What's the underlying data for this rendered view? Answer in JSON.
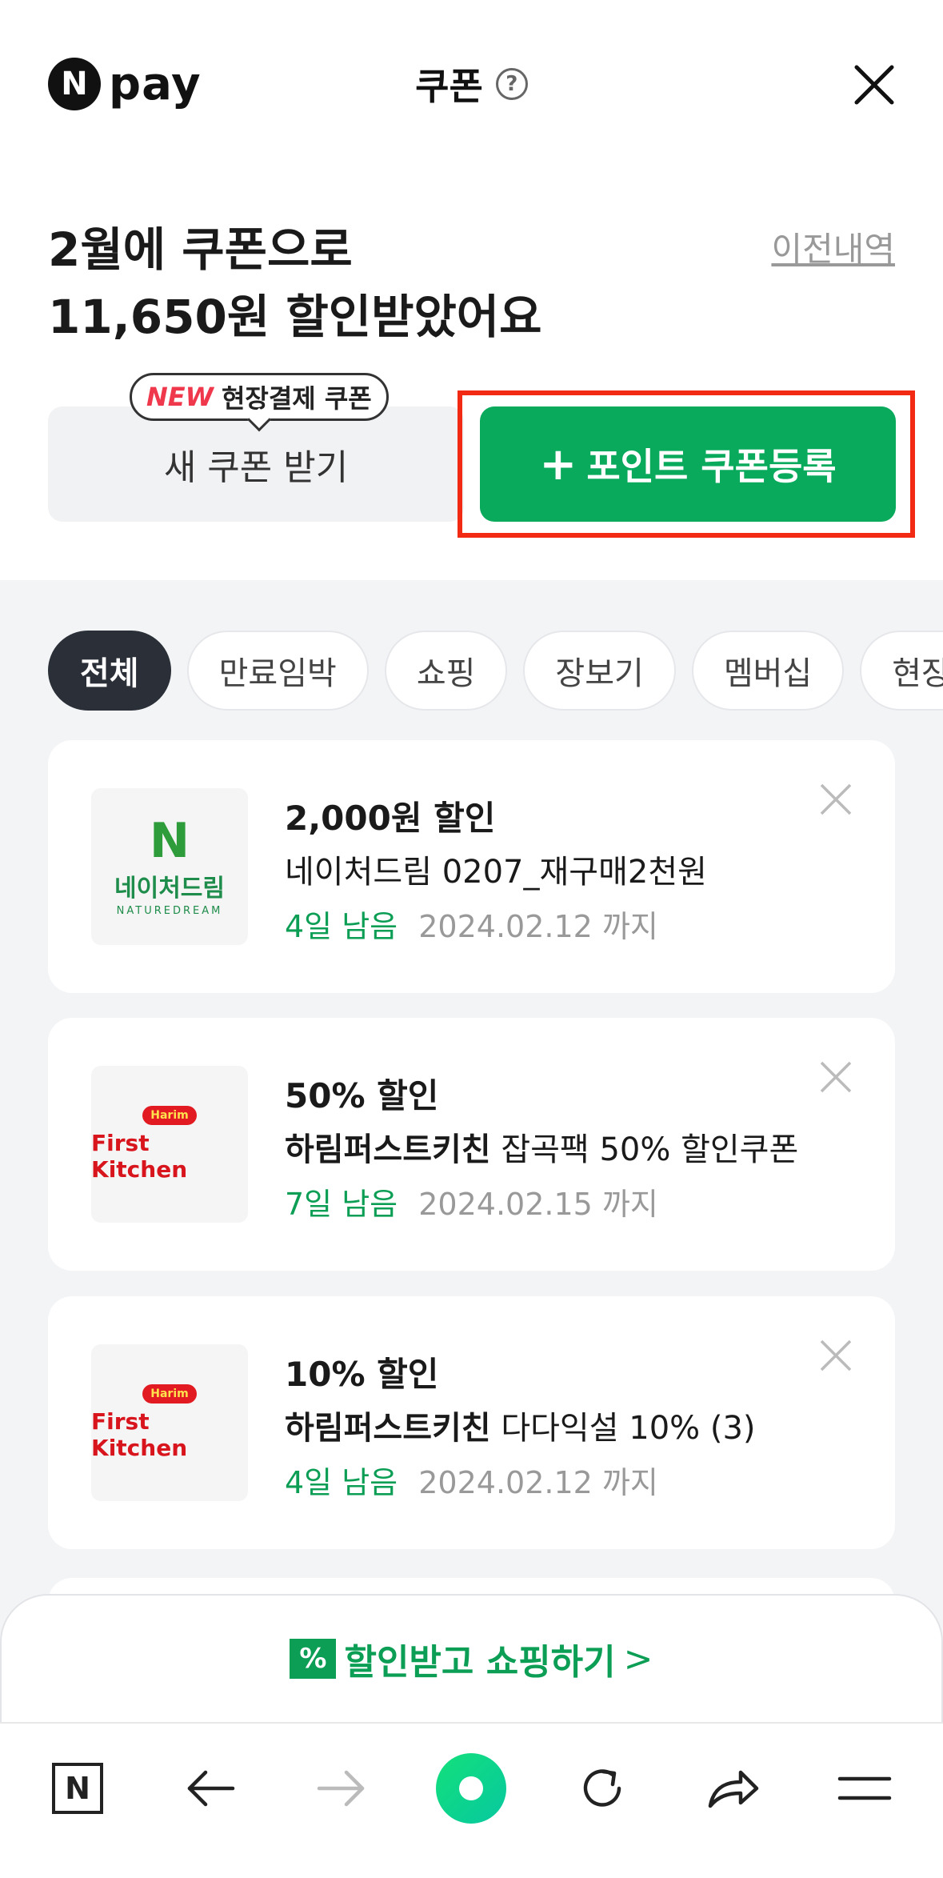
{
  "header": {
    "logo_letter": "N",
    "logo_text": "pay",
    "title": "쿠폰",
    "help_icon": "?"
  },
  "summary": {
    "line1": "2월에 쿠폰으로",
    "line2": "11,650원 할인받았어요",
    "history_link": "이전내역"
  },
  "actions": {
    "tooltip_new": "NEW",
    "tooltip_text": "현장결제 쿠폰",
    "new_coupon_label": "새 쿠폰 받기",
    "point_coupon_plus": "+",
    "point_coupon_label": "포인트 쿠폰등록"
  },
  "filters": [
    "전체",
    "만료임박",
    "쇼핑",
    "장보기",
    "멤버십",
    "현장"
  ],
  "coupons": [
    {
      "discount": "2,000원 할인",
      "brand": "",
      "title": "네이처드림 0207_재구매2천원",
      "days_left": "4일 남음",
      "until": "2024.02.12 까지",
      "logo": {
        "mark": "N",
        "name": "네이처드림",
        "sub": "NATUREDREAM"
      }
    },
    {
      "discount": "50% 할인",
      "brand": "하림퍼스트키친",
      "title": "잡곡팩 50% 할인쿠폰",
      "days_left": "7일 남음",
      "until": "2024.02.15 까지",
      "logo": {
        "badge": "Harim",
        "name": "First Kitchen"
      }
    },
    {
      "discount": "10% 할인",
      "brand": "하림퍼스트키친",
      "title": "다다익설 10% (3)",
      "days_left": "4일 남음",
      "until": "2024.02.12 까지",
      "logo": {
        "badge": "Harim",
        "name": "First Kitchen"
      }
    }
  ],
  "shop_banner": {
    "icon": "%",
    "label": "할인받고 쇼핑하기",
    "chevron": ">"
  },
  "colors": {
    "accent_green": "#09aa5c",
    "highlight_red": "#f22a14",
    "chip_active": "#2b3038"
  },
  "browser_bar": {
    "home_letter": "N"
  }
}
